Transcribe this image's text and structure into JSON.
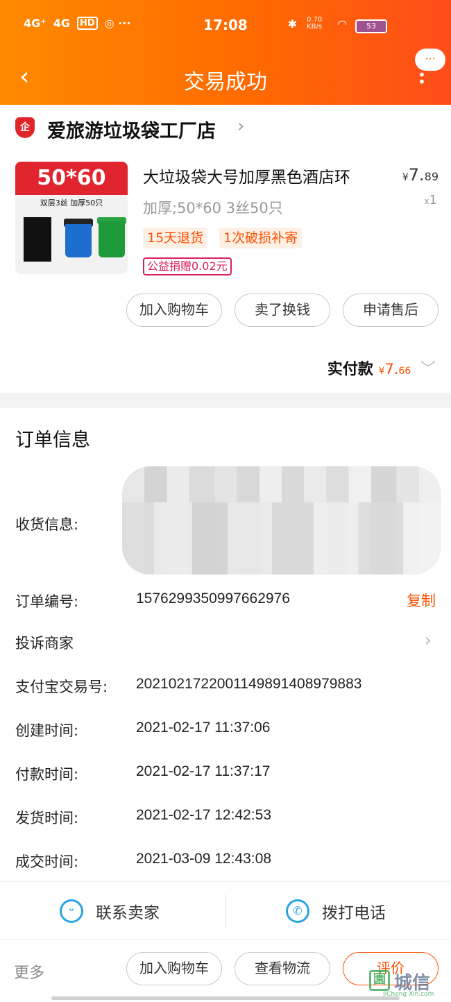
{
  "status_bar": {
    "signal_1": "4G⁺",
    "signal_2": "4G",
    "hd": "HD",
    "icons_extra": "◎ ···",
    "time": "17:08",
    "speed": "0.70 KB/s",
    "battery": "53"
  },
  "nav": {
    "title": "交易成功",
    "back_icon": "‹",
    "more_bubble": "···"
  },
  "shop": {
    "badge": "企",
    "name": "爱旅游垃圾袋工厂店",
    "arrow": "›"
  },
  "product": {
    "image_text": "50*60",
    "image_subtext": "双层3丝 加厚50只",
    "title": "大垃圾袋大号加厚黑色酒店环",
    "price_symbol": "¥",
    "price_int": "7.",
    "price_dec": "89",
    "sku": "加厚;50*60  3丝50只",
    "qty_prefix": "x",
    "qty": "1",
    "tags": [
      "15天退货",
      "1次破损补寄"
    ],
    "charity": "公益捐赠0.02元"
  },
  "actions": {
    "add_cart": "加入购物车",
    "sell": "卖了换钱",
    "after_sale": "申请售后"
  },
  "paid": {
    "label": "实付款",
    "symbol": "¥",
    "int": "7.",
    "dec": "66",
    "chev": "﹀"
  },
  "order_info": {
    "title": "订单信息",
    "receive_label": "收货信息:",
    "order_no_label": "订单编号:",
    "order_no": "1576299350997662976",
    "copy": "复制",
    "complain": "投诉商家",
    "alipay_label": "支付宝交易号:",
    "alipay_no": "2021021722001149891408979883",
    "created_label": "创建时间:",
    "created": "2021-02-17 11:37:06",
    "paid_label": "付款时间:",
    "paid_time": "2021-02-17 11:37:17",
    "shipped_label": "发货时间:",
    "shipped": "2021-02-17 12:42:53",
    "done_label": "成交时间:",
    "done": "2021-03-09 12:43:08"
  },
  "contact": {
    "seller": "联系卖家",
    "phone": "拨打电话"
  },
  "bottom": {
    "more": "更多",
    "add_cart": "加入购物车",
    "logistics": "查看物流",
    "review": "评价"
  },
  "watermark": {
    "logo": "園",
    "text": "城信",
    "url": "JiCheng Xin.com"
  }
}
